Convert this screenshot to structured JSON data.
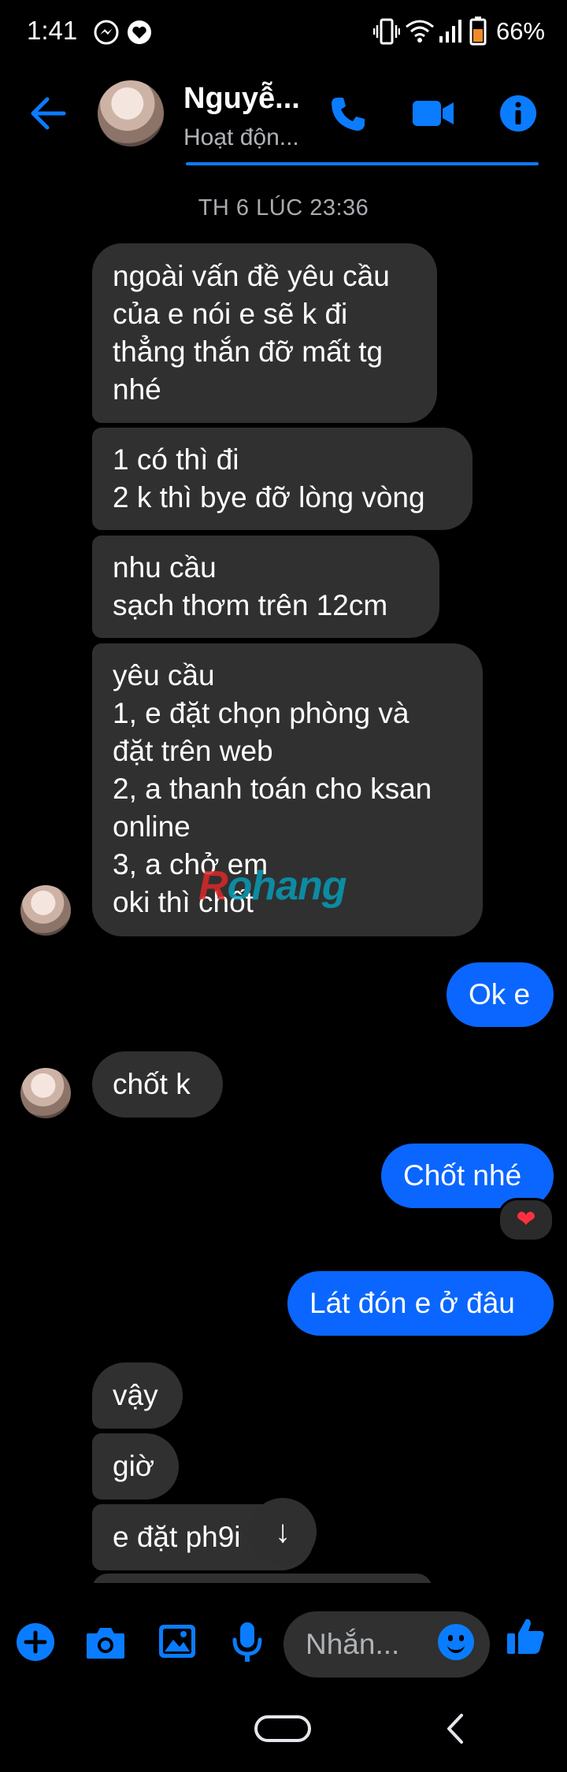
{
  "status_bar": {
    "time": "1:41",
    "battery": "66%",
    "icons": [
      "messenger-icon",
      "heart-message-icon",
      "vibrate-icon",
      "wifi-icon",
      "signal-icon",
      "battery-icon"
    ]
  },
  "header": {
    "contact_name": "Nguyễ...",
    "contact_status": "Hoạt độn...",
    "icons": [
      "back-arrow-icon",
      "phone-icon",
      "video-camera-icon",
      "info-icon"
    ],
    "accent_color": "#0a7cff"
  },
  "conversation": {
    "timestamp": "TH 6 LÚC 23:36",
    "messages": [
      {
        "from": "them",
        "text": "ngoài vấn đề yêu cầu\ncủa e nói e sẽ k đi\nthẳng thắn đỡ mất tg\nnhé"
      },
      {
        "from": "them",
        "text": "1 có thì đi\n2 k thì bye đỡ lòng vòng"
      },
      {
        "from": "them",
        "text": "nhu cầu\nsạch thơm trên 12cm"
      },
      {
        "from": "them",
        "text": "yêu cầu\n1, e đặt chọn phòng và\nđặt trên web\n2, a thanh toán cho ksan\nonline\n3, a chở em\noki thì chốt"
      },
      {
        "from": "me",
        "text": "Ok e"
      },
      {
        "from": "them",
        "text": "chốt k"
      },
      {
        "from": "me",
        "text": "Chốt nhé",
        "reaction": "❤"
      },
      {
        "from": "me",
        "text": "Lát đón e ở đâu"
      },
      {
        "from": "them",
        "text": "vậy"
      },
      {
        "from": "them",
        "text": "giờ"
      },
      {
        "from": "them",
        "text": "e đặt ph9i"
      }
    ],
    "watermark": {
      "part1": "R",
      "part2": "ohang"
    },
    "scroll_down_icon": "↓"
  },
  "composer": {
    "placeholder": "Nhắn...",
    "icons": [
      "plus-icon",
      "camera-icon",
      "image-icon",
      "microphone-icon",
      "emoji-icon",
      "thumbs-up-icon"
    ]
  },
  "nav_bar": {
    "icons": [
      "home-pill-icon",
      "back-chevron-icon"
    ]
  }
}
